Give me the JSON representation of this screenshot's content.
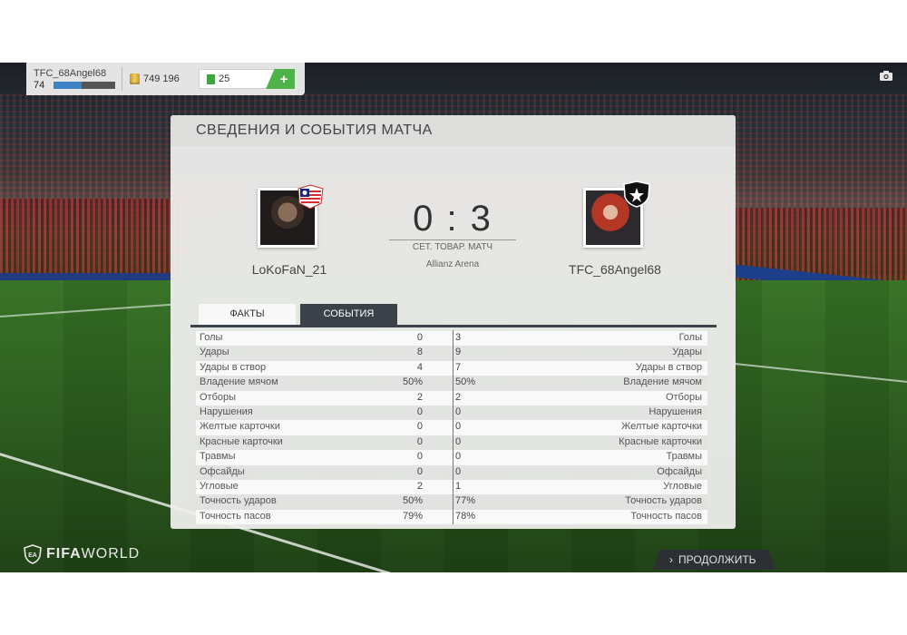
{
  "hud": {
    "player_name": "TFC_68Angel68",
    "level": "74",
    "xp_progress": 0.45,
    "coins": "749 196",
    "points": "25",
    "add_label": "+"
  },
  "panel": {
    "title": "СВЕДЕНИЯ И СОБЫТИЯ МАТЧА",
    "home_team": "LoKoFaN_21",
    "away_team": "TFC_68Angel68",
    "score": "0 : 3",
    "match_type": "СЕТ. ТОВАР. МАТЧ",
    "stadium": "Allianz Arena",
    "tabs": [
      {
        "label": "ФАКТЫ"
      },
      {
        "label": "СОБЫТИЯ"
      }
    ]
  },
  "stats": [
    {
      "label": "Голы",
      "home": "0",
      "away": "3"
    },
    {
      "label": "Удары",
      "home": "8",
      "away": "9"
    },
    {
      "label": "Удары в створ",
      "home": "4",
      "away": "7"
    },
    {
      "label": "Владение мячом",
      "home": "50%",
      "away": "50%"
    },
    {
      "label": "Отборы",
      "home": "2",
      "away": "2"
    },
    {
      "label": "Нарушения",
      "home": "0",
      "away": "0"
    },
    {
      "label": "Желтые карточки",
      "home": "0",
      "away": "0"
    },
    {
      "label": "Красные карточки",
      "home": "0",
      "away": "0"
    },
    {
      "label": "Травмы",
      "home": "0",
      "away": "0"
    },
    {
      "label": "Офсайды",
      "home": "0",
      "away": "0"
    },
    {
      "label": "Угловые",
      "home": "2",
      "away": "1"
    },
    {
      "label": "Точность ударов",
      "home": "50%",
      "away": "77%"
    },
    {
      "label": "Точность пасов",
      "home": "79%",
      "away": "78%"
    }
  ],
  "footer": {
    "logo_fifa": "FIFA",
    "logo_world": "WORLD",
    "continue_label": "ПРОДОЛЖИТЬ"
  },
  "colors": {
    "tab_active_bg": "#3c4249",
    "points_green": "#4fb34a",
    "xp_blue": "#3e83c4"
  },
  "icons": [
    "coin-icon",
    "points-icon",
    "add-icon",
    "camera-icon",
    "club-badge-icon",
    "ea-shield-icon",
    "chevron-right-icon"
  ]
}
